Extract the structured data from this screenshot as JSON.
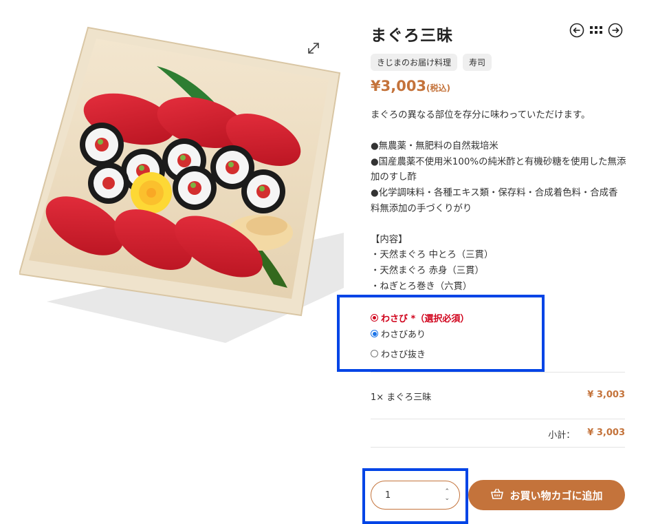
{
  "product": {
    "title": "まぐろ三昧",
    "tags": [
      "きじまのお届け料理",
      "寿司"
    ],
    "price": "¥3,003",
    "tax_note": "(税込)",
    "description": "まぐろの異なる部位を存分に味わっていただけます。\n\n●無農薬・無肥料の自然栽培米\n●国産農薬不使用米100%の純米酢と有機砂糖を使用した無添加のすし酢\n●化学調味料・各種エキス類・保存料・合成着色料・合成香料無添加の手づくりがり\n\n【内容】\n・天然まぐろ 中とろ（三貫）\n・天然まぐろ 赤身（三貫）\n・ねぎとろ巻き（六貫）"
  },
  "option": {
    "label": "わさび *（選択必須）",
    "choices": [
      {
        "label": "わさびあり",
        "selected": true
      },
      {
        "label": "わさび抜き",
        "selected": false
      }
    ]
  },
  "summary": {
    "line_item": "1× まぐろ三昧",
    "line_price": "¥ 3,003",
    "subtotal_label": "小計：",
    "subtotal_price": "¥ 3,003"
  },
  "cart": {
    "quantity": "1",
    "add_label": "お買い物カゴに追加"
  },
  "icons": {
    "expand": "expand-icon",
    "prev": "arrow-left-circle-icon",
    "grid": "grid-icon",
    "next": "arrow-right-circle-icon",
    "basket": "basket-icon"
  },
  "colors": {
    "accent": "#c4733b",
    "required": "#d0021b",
    "highlight": "#0044e6",
    "radio": "#1a73e8"
  }
}
